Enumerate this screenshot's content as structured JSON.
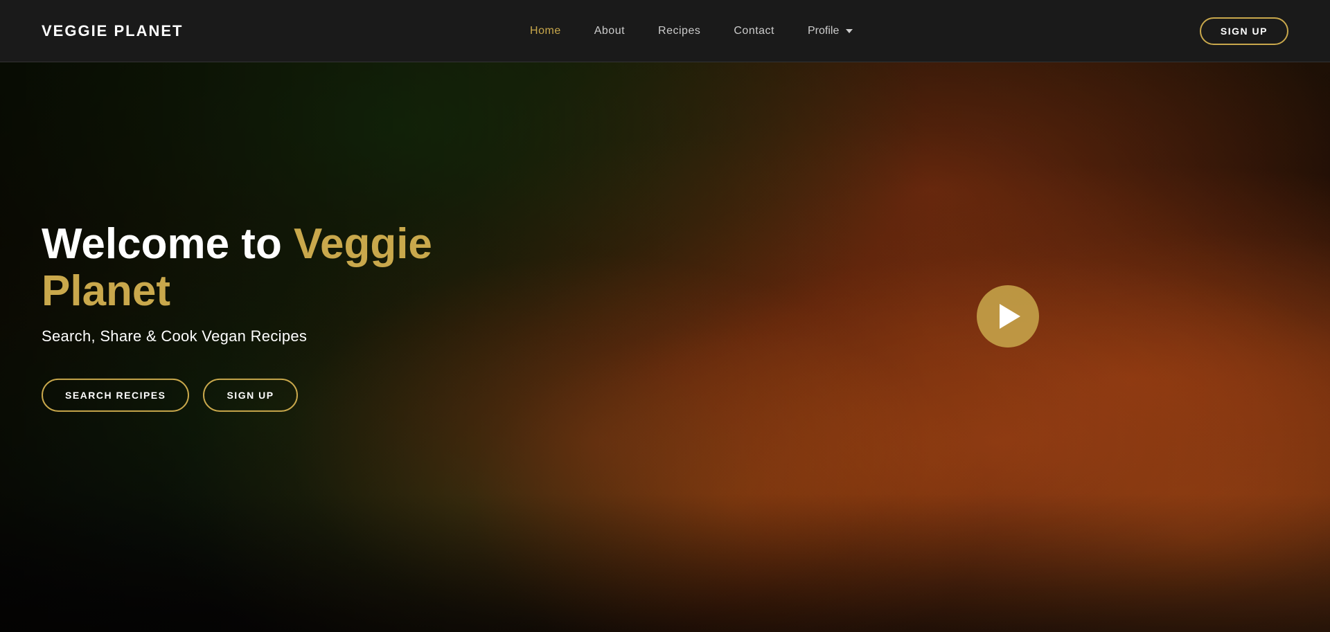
{
  "nav": {
    "logo": "VEGGIE PLANET",
    "links": [
      {
        "id": "home",
        "label": "Home",
        "active": true
      },
      {
        "id": "about",
        "label": "About",
        "active": false
      },
      {
        "id": "recipes",
        "label": "Recipes",
        "active": false
      },
      {
        "id": "contact",
        "label": "Contact",
        "active": false
      }
    ],
    "profile_label": "Profile",
    "signup_label": "SIGN UP"
  },
  "hero": {
    "title_prefix": "Welcome to ",
    "title_accent": "Veggie Planet",
    "subtitle": "Search, Share & Cook Vegan Recipes",
    "search_btn": "SEARCH RECIPES",
    "signup_btn": "SIGN UP",
    "play_aria": "Play video"
  },
  "colors": {
    "accent": "#c9a84c",
    "bg_dark": "#1a1a1a",
    "text_white": "#ffffff",
    "text_gray": "#cccccc"
  }
}
